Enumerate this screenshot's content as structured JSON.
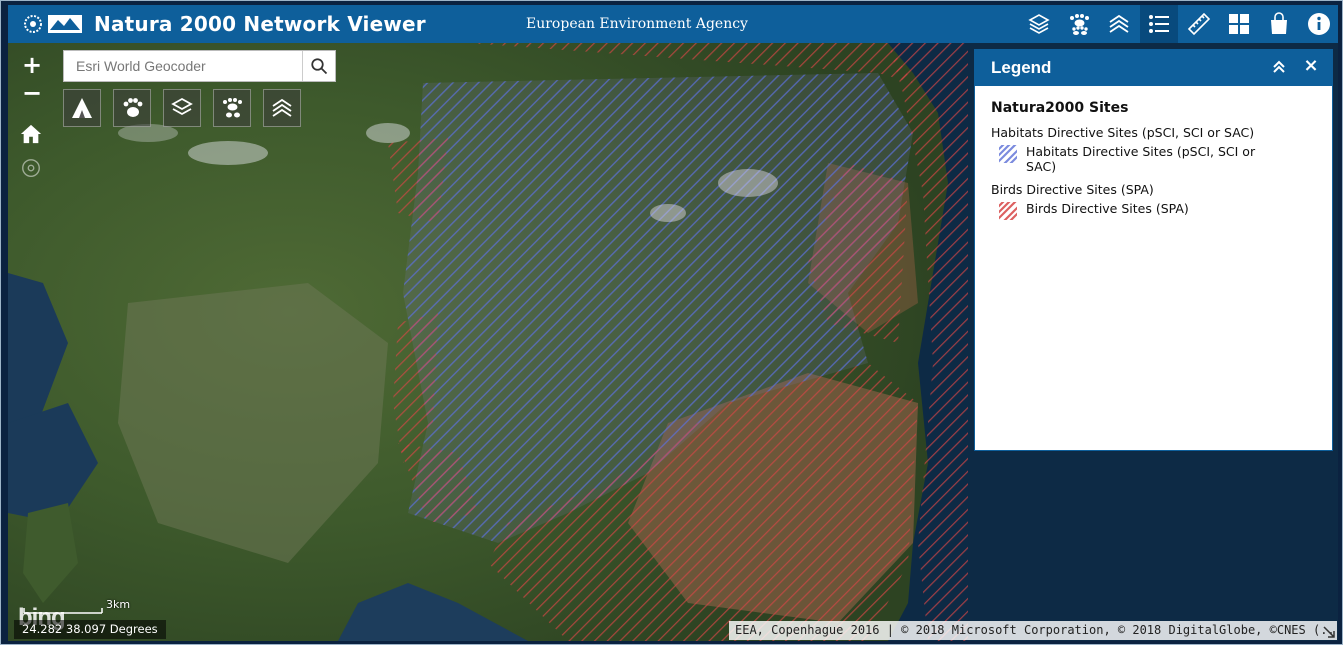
{
  "header": {
    "title": "Natura 2000 Network Viewer",
    "subtitle": "European Environment Agency",
    "logo_alt": "EEA",
    "tools": [
      {
        "name": "basemap-gallery",
        "icon": "layers-icon",
        "active": false
      },
      {
        "name": "species",
        "icon": "paw-prints-icon",
        "active": false
      },
      {
        "name": "layer-list",
        "icon": "stacked-chevrons-icon",
        "active": false
      },
      {
        "name": "legend",
        "icon": "legend-list-icon",
        "active": true
      },
      {
        "name": "measurement",
        "icon": "ruler-icon",
        "active": false
      },
      {
        "name": "overview",
        "icon": "grid-icon",
        "active": false
      },
      {
        "name": "print",
        "icon": "shopping-bag-icon",
        "active": false
      },
      {
        "name": "about",
        "icon": "info-icon",
        "active": false
      }
    ]
  },
  "map": {
    "zoom_in": "+",
    "zoom_out": "−",
    "search": {
      "placeholder": "Esri World Geocoder"
    },
    "layer_buttons": [
      "habitats-icon",
      "birds-paw-icon",
      "landscape-icon",
      "species-paw-icon",
      "chevrons-icon"
    ]
  },
  "legend": {
    "title": "Legend",
    "close": "×",
    "heading": "Natura2000 Sites",
    "groups": [
      {
        "label": "Habitats Directive Sites (pSCI, SCI or SAC)",
        "item": "Habitats Directive Sites (pSCI, SCI or SAC)",
        "color": "#5b6fd6"
      },
      {
        "label": "Birds Directive Sites (SPA)",
        "item": "Birds Directive Sites (SPA)",
        "color": "#d64545"
      }
    ]
  },
  "footer": {
    "bing": "bing",
    "scale_label": "3km",
    "coordinates": "24.282 38.097 Degrees",
    "attribution": "EEA, Copenhague 2016 | © 2018 Microsoft Corporation, © 2018 DigitalGlobe, ©CNES (..."
  }
}
